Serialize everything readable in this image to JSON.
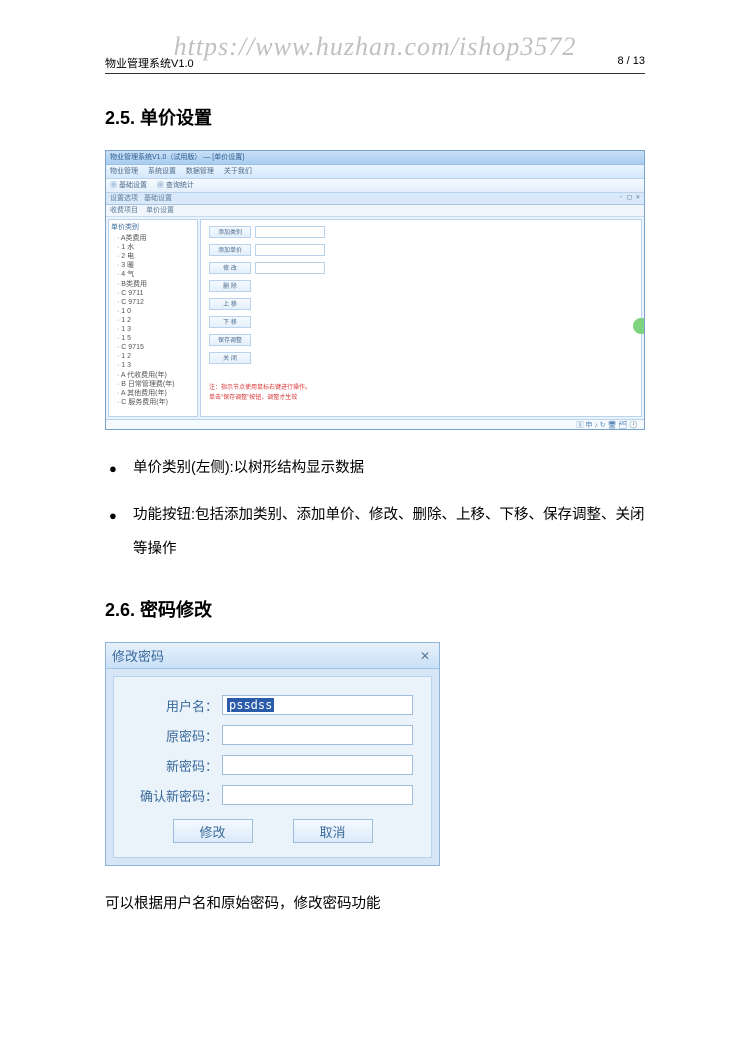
{
  "watermark": "https://www.huzhan.com/ishop3572",
  "header": {
    "left": "物业管理系统V1.0",
    "right": "8 / 13"
  },
  "section25": {
    "title": "2.5. 单价设置"
  },
  "app": {
    "title": "物业管理系统V1.0（试用版） — [单价设置]",
    "menu": [
      "物业管理",
      "系统设置",
      "数据管理",
      "关于我们"
    ],
    "toolbar": [
      "基础设置",
      "查询统计"
    ],
    "tabbar_left": [
      "设置选项",
      "基础设置"
    ],
    "tabbar_right": "- □ ×",
    "subtabs": [
      "收费项目",
      "单价设置"
    ],
    "tree_title": "单价类别",
    "tree": [
      "A类费用",
      "  1 水",
      "  2 电",
      "  3 暖",
      "  4 气",
      "B类费用",
      "  C 9711",
      "  C 9712",
      "  1 0",
      "  1 2",
      "  1 3",
      "  1 5",
      "  C 9715",
      "  1 2",
      "  1 3",
      "A 代收费用(年)",
      "B 日常管理费(年)",
      "A 其他费用(年)",
      "C 服务费用(年)"
    ],
    "form_labels": {
      "add_cat": "添加类别",
      "add_price": "添加单价",
      "modify": "修 改"
    },
    "buttons": [
      "删 除",
      "上 移",
      "下 移",
      "保存调整",
      "关 闭"
    ],
    "note1": "注：指示节点使用鼠标右键进行操作。",
    "note2": "单击\"保存调整\"按钮，调整才生效",
    "status_icons": "🅂 申 ♪ ↻ 🖥 🗂 🕐"
  },
  "bullets": [
    "单价类别(左侧):以树形结构显示数据",
    "功能按钮:包括添加类别、添加单价、修改、删除、上移、下移、保存调整、关闭等操作"
  ],
  "section26": {
    "title": "2.6. 密码修改"
  },
  "dialog": {
    "title": "修改密码",
    "labels": {
      "user": "用户名：",
      "old": "原密码：",
      "new": "新密码：",
      "confirm": "确认新密码："
    },
    "user_value": "pssdss",
    "buttons": {
      "modify": "修改",
      "cancel": "取消"
    }
  },
  "desc": "可以根据用户名和原始密码，修改密码功能"
}
